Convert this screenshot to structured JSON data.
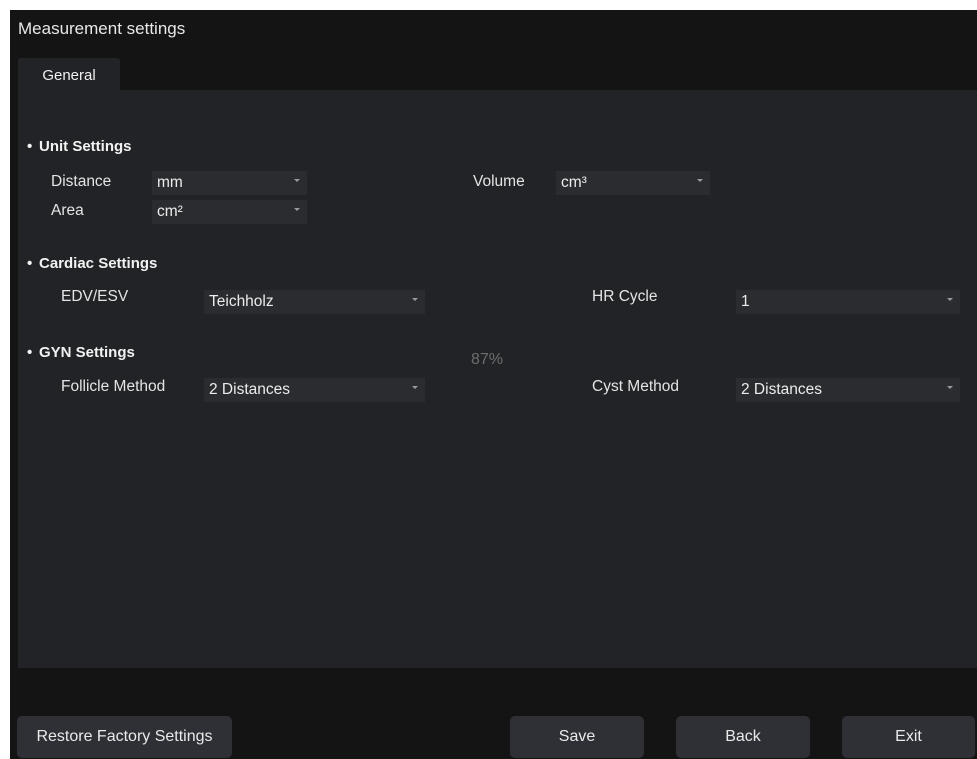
{
  "window": {
    "title": "Measurement settings"
  },
  "tabs": [
    {
      "label": "General"
    }
  ],
  "unit_settings": {
    "heading": "Unit Settings",
    "distance": {
      "label": "Distance",
      "value": "mm"
    },
    "area": {
      "label": "Area",
      "value": "cm²"
    },
    "volume": {
      "label": "Volume",
      "value": "cm³"
    }
  },
  "cardiac_settings": {
    "heading": "Cardiac Settings",
    "edv_esv": {
      "label": "EDV/ESV",
      "value": "Teichholz"
    },
    "hr_cycle": {
      "label": "HR Cycle",
      "value": "1"
    }
  },
  "gyn_settings": {
    "heading": "GYN Settings",
    "follicle_method": {
      "label": "Follicle Method",
      "value": "2 Distances"
    },
    "cyst_method": {
      "label": "Cyst Method",
      "value": "2 Distances"
    }
  },
  "overlay": {
    "percent": "87%"
  },
  "buttons": {
    "restore": "Restore Factory Settings",
    "save": "Save",
    "back": "Back",
    "exit": "Exit"
  },
  "icons": {
    "dropdown": "chevron-down-icon",
    "bullet": "bullet-dot-icon"
  },
  "colors": {
    "background": "#141414",
    "panel": "#222326",
    "field": "#2b2c30",
    "button": "#2e3035",
    "text": "#e6e6e6",
    "muted": "#6e6e6e"
  }
}
